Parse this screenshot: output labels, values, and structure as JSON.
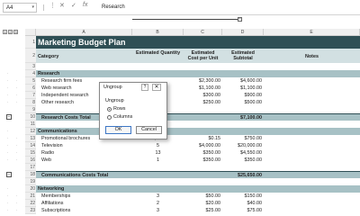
{
  "formula_bar": {
    "name_box": "A4",
    "cancel": "✕",
    "enter": "✓",
    "fx": "fx",
    "value": "Research"
  },
  "outline_levels": [
    "1",
    "2",
    "3",
    "1",
    "2"
  ],
  "columns": [
    "A",
    "B",
    "C",
    "D",
    "E"
  ],
  "rows": [
    {
      "n": "1",
      "type": "title",
      "a": "Marketing Budget Plan"
    },
    {
      "n": "2",
      "type": "header",
      "a": "Category",
      "b": "Estimated Quantity",
      "c": "Estimated Cost per Unit",
      "d": "Estimated Subtotal",
      "e": "Notes"
    },
    {
      "n": "3",
      "type": "blank"
    },
    {
      "n": "4",
      "type": "section",
      "a": "Research"
    },
    {
      "n": "5",
      "type": "item",
      "a": "Research firm fees",
      "b": "",
      "c": "$2,300.00",
      "d": "$4,600.00"
    },
    {
      "n": "6",
      "type": "item",
      "a": "Web research",
      "b": "",
      "c": "$1,100.00",
      "d": "$1,100.00"
    },
    {
      "n": "7",
      "type": "item",
      "a": "Independent research",
      "b": "",
      "c": "$300.00",
      "d": "$900.00"
    },
    {
      "n": "8",
      "type": "item",
      "a": "Other research",
      "b": "",
      "c": "$250.00",
      "d": "$500.00"
    },
    {
      "n": "9",
      "type": "blank"
    },
    {
      "n": "10",
      "type": "total",
      "a": "Research Costs Total",
      "d": "$7,100.00"
    },
    {
      "n": "11",
      "type": "blank"
    },
    {
      "n": "12",
      "type": "section",
      "a": "Communications"
    },
    {
      "n": "13",
      "type": "item",
      "a": "Promotional brochures",
      "b": "5,000",
      "c": "$0.15",
      "d": "$750.00"
    },
    {
      "n": "14",
      "type": "item",
      "a": "Television",
      "b": "5",
      "c": "$4,000.00",
      "d": "$20,000.00"
    },
    {
      "n": "15",
      "type": "item",
      "a": "Radio",
      "b": "13",
      "c": "$350.00",
      "d": "$4,550.00"
    },
    {
      "n": "16",
      "type": "item",
      "a": "Web",
      "b": "1",
      "c": "$350.00",
      "d": "$350.00"
    },
    {
      "n": "17",
      "type": "blank"
    },
    {
      "n": "18",
      "type": "total",
      "a": "Communications Costs Total",
      "d": "$25,650.00"
    },
    {
      "n": "19",
      "type": "blank"
    },
    {
      "n": "20",
      "type": "section",
      "a": "Networking"
    },
    {
      "n": "21",
      "type": "item",
      "a": "Memberships",
      "b": "3",
      "c": "$50.00",
      "d": "$150.00"
    },
    {
      "n": "22",
      "type": "item",
      "a": "Affiliations",
      "b": "2",
      "c": "$20.00",
      "d": "$40.00"
    },
    {
      "n": "23",
      "type": "item",
      "a": "Subscriptions",
      "b": "3",
      "c": "$25.00",
      "d": "$75.00"
    }
  ],
  "dialog": {
    "title": "Ungroup",
    "help": "?",
    "close": "✕",
    "group_label": "Ungroup",
    "options": [
      "Rows",
      "Columns"
    ],
    "selected": "Rows",
    "ok": "OK",
    "cancel": "Cancel"
  },
  "colors": {
    "title_bg": "#2f4f55",
    "header_bg": "#d2e0e2",
    "section_bg": "#a7c1c5",
    "total_bg": "#a7c1c5"
  }
}
